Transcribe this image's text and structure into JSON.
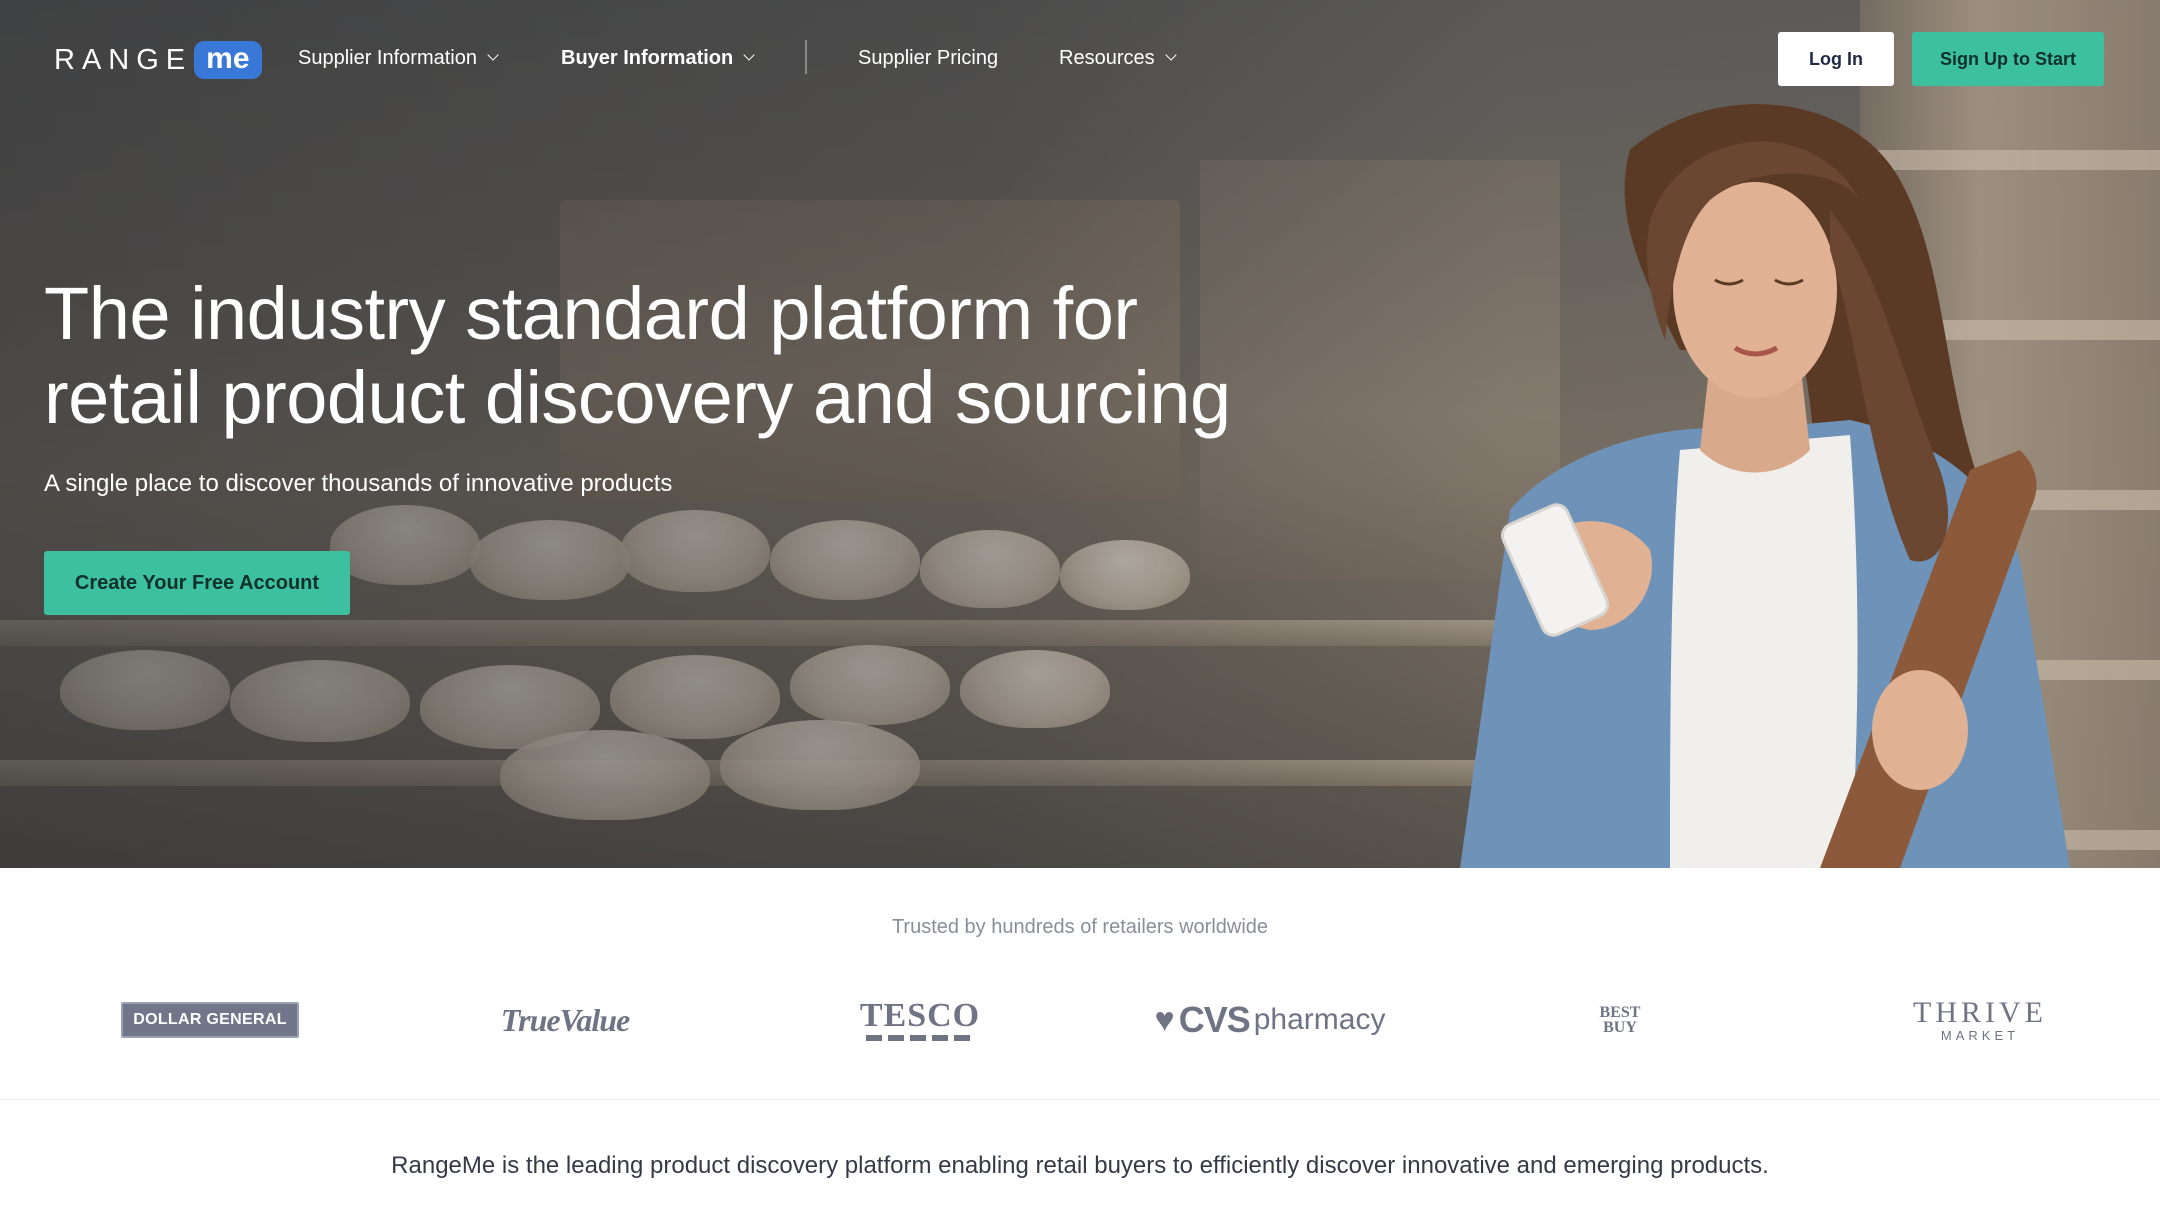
{
  "brand": {
    "logo_main": "RANGE",
    "logo_accent": "me"
  },
  "nav": {
    "items": [
      {
        "label": "Supplier Information",
        "has_dropdown": true
      },
      {
        "label": "Buyer Information",
        "has_dropdown": true
      },
      {
        "label": "Supplier Pricing",
        "has_dropdown": false
      },
      {
        "label": "Resources",
        "has_dropdown": true
      }
    ],
    "login_label": "Log In",
    "signup_label": "Sign Up to Start"
  },
  "hero": {
    "title_line1": "The industry standard platform for",
    "title_line2": "retail product discovery and sourcing",
    "subtitle": "A single place to discover thousands of innovative products",
    "cta_label": "Create Your Free Account"
  },
  "trust": {
    "heading": "Trusted by hundreds of retailers worldwide",
    "retailers": [
      {
        "name": "DOLLAR GENERAL"
      },
      {
        "name": "TrueValue"
      },
      {
        "name": "TESCO"
      },
      {
        "name": "CVS",
        "suffix": "pharmacy"
      },
      {
        "name_line1": "BEST",
        "name_line2": "BUY"
      },
      {
        "name": "THRIVE",
        "sub": "MARKET"
      }
    ]
  },
  "tagline": "RangeMe is the leading product discovery platform enabling retail buyers to efficiently discover innovative and emerging products.",
  "colors": {
    "accent": "#3cc0a0",
    "logo_blue": "#3a78d8",
    "retailer_logo_gray": "#6f7485"
  },
  "icons": [
    "chevron-down-icon",
    "heart-icon"
  ]
}
